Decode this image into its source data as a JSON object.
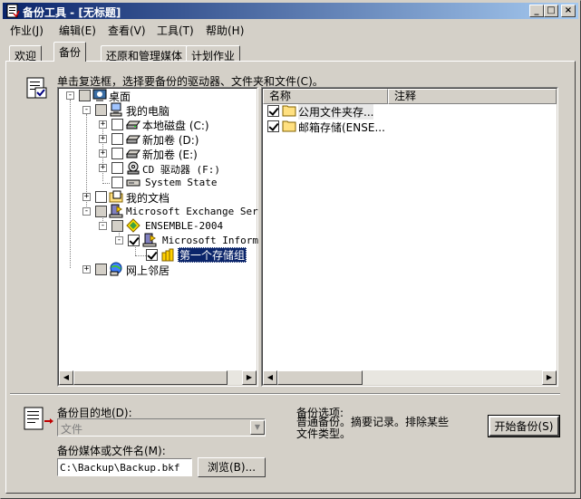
{
  "window": {
    "title": "备份工具 - [无标题]"
  },
  "titlebar_buttons": {
    "minimize": "_",
    "maximize": "□",
    "close": "×"
  },
  "menus": [
    "作业(J)",
    "编辑(E)",
    "查看(V)",
    "工具(T)",
    "帮助(H)"
  ],
  "tabs": [
    "欢迎",
    "备份",
    "还原和管理媒体",
    "计划作业"
  ],
  "instruction": "单击复选框，选择要备份的驱动器、文件夹和文件(C)。",
  "tree": {
    "desktop": "桌面",
    "my_computer": "我的电脑",
    "local_disk": "本地磁盘 (C:)",
    "volume_d": "新加卷 (D:)",
    "volume_e": "新加卷 (E:)",
    "cd_drive": "CD 驱动器 (F:)",
    "system_state": "System State",
    "my_documents": "我的文档",
    "exchange": "Microsoft Exchange Serve",
    "server": "ENSEMBLE-2004",
    "info_store": "Microsoft Informa",
    "storage_group": "第一个存储组",
    "network": "网上邻居"
  },
  "list": {
    "col_name": "名称",
    "col_note": "注释",
    "items": [
      "公用文件夹存...",
      "邮箱存储(ENSE..."
    ]
  },
  "destination": {
    "label": "备份目的地(D):",
    "value": "文件"
  },
  "media": {
    "label": "备份媒体或文件名(M):",
    "value": "C:\\Backup\\Backup.bkf",
    "browse": "浏览(B)..."
  },
  "options": {
    "title": "备份选项:",
    "text": "普通备份。摘要记录。排除某些文件类型。"
  },
  "start_button": "开始备份(S)",
  "colors": {
    "title_start": "#0a246a",
    "title_end": "#a6caf0",
    "face": "#d4d0c8",
    "selection": "#0a246a"
  }
}
